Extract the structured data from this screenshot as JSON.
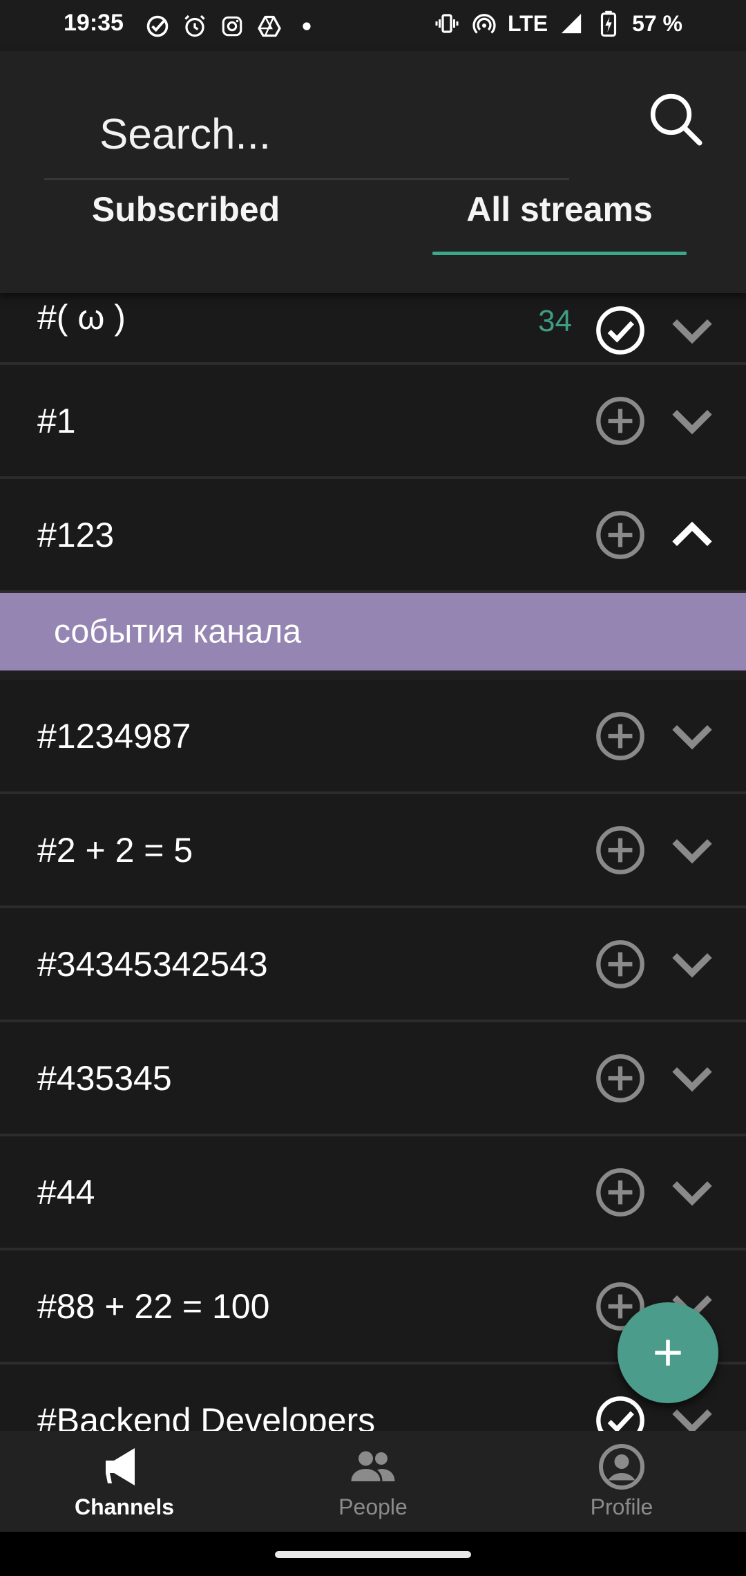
{
  "status_bar": {
    "time": "19:35",
    "network": "LTE",
    "battery": "57 %",
    "left_icons": [
      "check-circle-icon",
      "alarm-icon",
      "instagram-icon",
      "drive-icon",
      "dot-icon"
    ],
    "right_icons": [
      "vibrate-icon",
      "hotspot-icon",
      "signal-icon",
      "battery-charging-icon"
    ]
  },
  "search": {
    "placeholder": "Search..."
  },
  "tabs": [
    {
      "label": "Subscribed",
      "active": false
    },
    {
      "label": "All streams",
      "active": true
    }
  ],
  "streams": [
    {
      "name": "#( ω )",
      "count": "34",
      "subscribed": true,
      "expanded": false
    },
    {
      "name": "#1",
      "subscribed": false,
      "expanded": false
    },
    {
      "name": "#123",
      "subscribed": false,
      "expanded": true
    },
    {
      "name": "#1234987",
      "subscribed": false,
      "expanded": false
    },
    {
      "name": "#2 + 2 = 5",
      "subscribed": false,
      "expanded": false
    },
    {
      "name": "#34345342543",
      "subscribed": false,
      "expanded": false
    },
    {
      "name": "#435345",
      "subscribed": false,
      "expanded": false
    },
    {
      "name": "#44",
      "subscribed": false,
      "expanded": false
    },
    {
      "name": "#88 + 22 = 100",
      "subscribed": false,
      "expanded": false
    },
    {
      "name": "#Backend Developers",
      "subscribed": true,
      "expanded": false
    }
  ],
  "topic": {
    "label": "события канала"
  },
  "bottom_nav": [
    {
      "label": "Channels",
      "icon": "megaphone-icon",
      "active": true
    },
    {
      "label": "People",
      "icon": "people-icon",
      "active": false
    },
    {
      "label": "Profile",
      "icon": "profile-icon",
      "active": false
    }
  ],
  "colors": {
    "accent": "#3ba889",
    "topic_bg": "#9585b2",
    "fab": "#4b9c8a",
    "count": "#3f9d84"
  }
}
